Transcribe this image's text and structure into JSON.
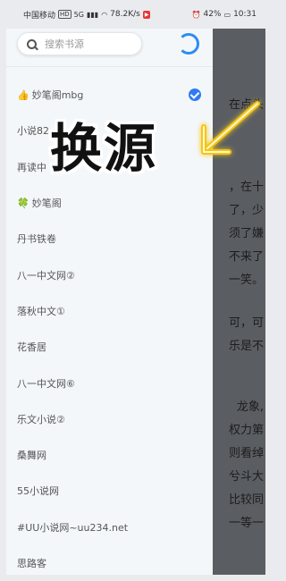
{
  "status_bar": {
    "carrier": "中国移动",
    "hd": "HD",
    "signal": "5G",
    "speed": "78.2K/s",
    "battery": "42%",
    "time": "10:31"
  },
  "search": {
    "placeholder": "搜索书源"
  },
  "sources": [
    {
      "emoji": "👍",
      "label": "妙笔阁mbg",
      "selected": true
    },
    {
      "emoji": "",
      "label": "小说82",
      "selected": false
    },
    {
      "emoji": "",
      "label": "再读中",
      "selected": false
    },
    {
      "emoji": "🍀",
      "label": "妙笔阁",
      "selected": false
    },
    {
      "emoji": "",
      "label": "丹书铁卷",
      "selected": false
    },
    {
      "emoji": "",
      "label": "八一中文网②",
      "selected": false
    },
    {
      "emoji": "",
      "label": "落秋中文①",
      "selected": false
    },
    {
      "emoji": "",
      "label": "花香居",
      "selected": false
    },
    {
      "emoji": "",
      "label": "八一中文网⑥",
      "selected": false
    },
    {
      "emoji": "",
      "label": "乐文小说②",
      "selected": false
    },
    {
      "emoji": "",
      "label": "桑舞网",
      "selected": false
    },
    {
      "emoji": "",
      "label": "55小说网",
      "selected": false
    },
    {
      "emoji": "",
      "label": "#UU小说网~uu234.net",
      "selected": false
    },
    {
      "emoji": "",
      "label": "思路客",
      "selected": false
    }
  ],
  "overlay": {
    "caption": "换源"
  },
  "reader_lines": [
    "在点头",
    "，在十",
    "了，少",
    "须了嫌",
    "不来了",
    "一笑。",
    "可，可",
    "乐是不",
    "龙象,",
    "权力第",
    "则看绰",
    "兮斗大",
    "比较同",
    "一等一"
  ],
  "colors": {
    "accent": "#2f7bf5",
    "drawer_bg": "#f4f7fa",
    "reader_bg": "#5a5e63",
    "arrow": "#f5c518"
  }
}
